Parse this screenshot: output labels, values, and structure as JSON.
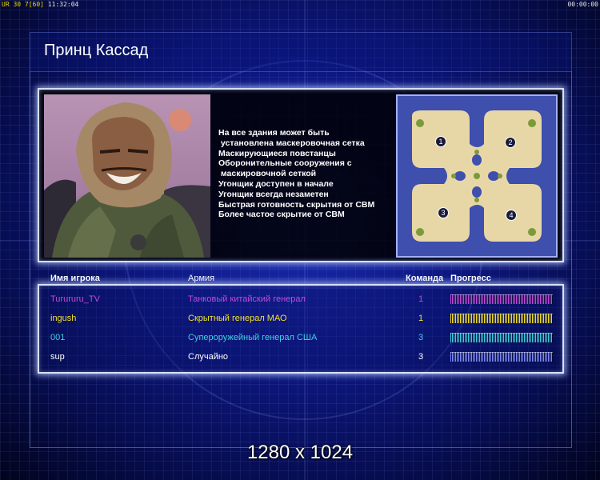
{
  "topbar": {
    "left_prefix": "UR 30 7",
    "left_bracket": "[60]",
    "clock": "11:32:04",
    "right_timer": "00:00:00"
  },
  "title": "Принц Кассад",
  "description_lines": [
    "На все здания может быть",
    " установлена маскеровочная сетка",
    "Маскирующиеся повстанцы",
    "Оборонительные сооружения с",
    " маскировочной сеткой",
    "Угонщик доступен в начале",
    "Угонщик всегда незаметен",
    "Быстрая готовность скрытия от СВМ",
    "Более частое скрытие от СВМ"
  ],
  "minimap": {
    "start_positions": [
      "1",
      "2",
      "3",
      "4"
    ]
  },
  "table": {
    "headers": {
      "player": "Имя игрока",
      "army": "Армия",
      "team": "Команда",
      "progress": "Прогресс"
    },
    "rows": [
      {
        "player": "Turururu_TV",
        "army": "Танковый китайский генерал",
        "team": "1",
        "color": "#c04ad8",
        "progress": 1.0
      },
      {
        "player": "ingush",
        "army": "Скрытный генерал МАО",
        "team": "1",
        "color": "#f0e030",
        "progress": 1.0
      },
      {
        "player": "001",
        "army": "Супероружейный генерал США",
        "team": "3",
        "color": "#40d0e0",
        "progress": 1.0
      },
      {
        "player": "sup",
        "army": "Случайно",
        "team": "3",
        "color": "#ffffff",
        "progress": 1.0
      }
    ]
  },
  "resolution": "1280 x 1024",
  "colors": {
    "panel_border": "#d8e0ff",
    "bar_row4": "#7f8cff"
  }
}
